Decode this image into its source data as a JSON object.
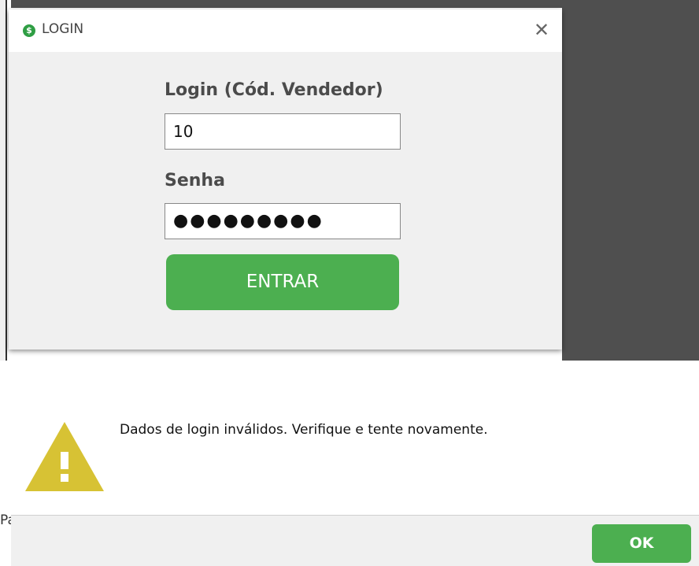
{
  "login_window": {
    "title": "LOGIN",
    "app_icon_glyph": "$",
    "close_glyph": "✕",
    "login_label": "Login (Cód. Vendedor)",
    "login_value": "10",
    "senha_label": "Senha",
    "senha_value": "●●●●●●●●●",
    "entrar_label": "ENTRAR"
  },
  "alert": {
    "message": "Dados de login inválidos. Verifique e tente novamente.",
    "ok_label": "OK",
    "icon": "warning-icon"
  },
  "background": {
    "partial_text": "Pa"
  },
  "colors": {
    "accent_green": "#4caf50",
    "warning_yellow": "#d7c234",
    "dark_background": "#4f4f4f"
  }
}
